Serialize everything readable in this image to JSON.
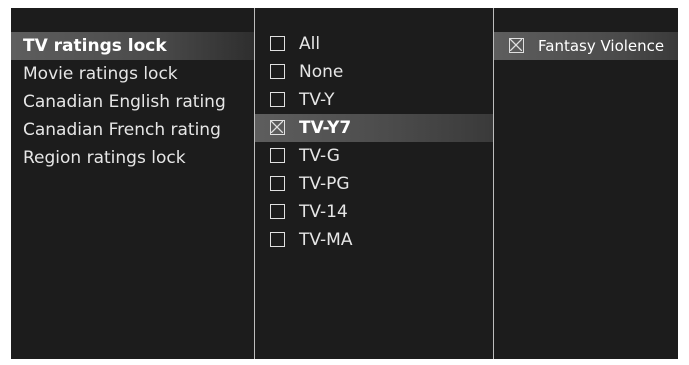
{
  "categories": [
    {
      "label": "TV ratings lock",
      "selected": true
    },
    {
      "label": "Movie ratings lock",
      "selected": false
    },
    {
      "label": "Canadian English rating",
      "selected": false
    },
    {
      "label": "Canadian French rating",
      "selected": false
    },
    {
      "label": "Region ratings lock",
      "selected": false
    }
  ],
  "ratings": [
    {
      "label": "All",
      "checked": false,
      "selected": false
    },
    {
      "label": "None",
      "checked": false,
      "selected": false
    },
    {
      "label": "TV-Y",
      "checked": false,
      "selected": false
    },
    {
      "label": "TV-Y7",
      "checked": true,
      "selected": true
    },
    {
      "label": "TV-G",
      "checked": false,
      "selected": false
    },
    {
      "label": "TV-PG",
      "checked": false,
      "selected": false
    },
    {
      "label": "TV-14",
      "checked": false,
      "selected": false
    },
    {
      "label": "TV-MA",
      "checked": false,
      "selected": false
    }
  ],
  "sub_ratings": [
    {
      "label": "Fantasy Violence",
      "checked": true,
      "selected": true
    }
  ],
  "colors": {
    "background": "#1c1c1c",
    "text": "#e6e6e6",
    "highlight": "#4a4a4a",
    "divider": "#bdbdbd"
  }
}
